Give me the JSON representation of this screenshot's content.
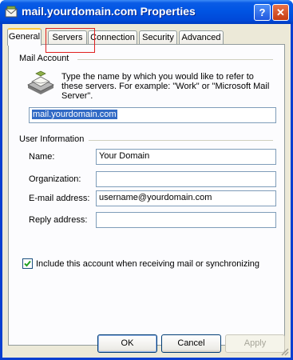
{
  "window": {
    "title": "mail.yourdomain.com Properties"
  },
  "titlebar": {
    "help_glyph": "?",
    "close_glyph": "✕"
  },
  "tabs": [
    {
      "label": "General"
    },
    {
      "label": "Servers"
    },
    {
      "label": "Connection"
    },
    {
      "label": "Security"
    },
    {
      "label": "Advanced"
    }
  ],
  "mail_account": {
    "heading": "Mail Account",
    "description": "Type the name by which you would like to refer to these servers.  For example: \"Work\" or \"Microsoft Mail Server\".",
    "account_name": "mail.yourdomain.com"
  },
  "user_information": {
    "heading": "User Information",
    "name_label": "Name:",
    "name_value": "Your Domain",
    "organization_label": "Organization:",
    "organization_value": "",
    "email_label": "E-mail address:",
    "email_value": "username@yourdomain.com",
    "reply_label": "Reply address:",
    "reply_value": ""
  },
  "include_account": {
    "label": "Include this account when receiving mail or synchronizing",
    "checked": true
  },
  "buttons": {
    "ok": "OK",
    "cancel": "Cancel",
    "apply": "Apply"
  },
  "colors": {
    "titlebar": "#0054e3",
    "face": "#ece9d8",
    "selection": "#316ac5",
    "highlight_box": "#e02020"
  }
}
